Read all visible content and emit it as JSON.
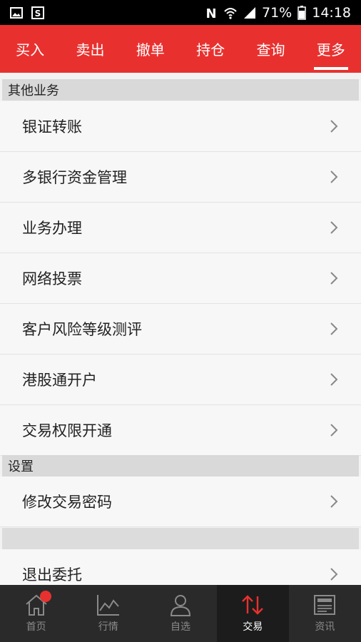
{
  "status_bar": {
    "battery": "71%",
    "time": "14:18"
  },
  "tabs": [
    {
      "label": "买入",
      "active": false
    },
    {
      "label": "卖出",
      "active": false
    },
    {
      "label": "撤单",
      "active": false
    },
    {
      "label": "持仓",
      "active": false
    },
    {
      "label": "查询",
      "active": false
    },
    {
      "label": "更多",
      "active": true
    }
  ],
  "sections": {
    "other": {
      "title": "其他业务",
      "items": [
        "银证转账",
        "多银行资金管理",
        "业务办理",
        "网络投票",
        "客户风险等级测评",
        "港股通开户",
        "交易权限开通"
      ]
    },
    "settings": {
      "title": "设置",
      "items": [
        "修改交易密码"
      ]
    },
    "exit": {
      "label": "退出委托"
    }
  },
  "bottom_nav": [
    {
      "label": "首页",
      "icon": "home-icon",
      "active": false,
      "badge": true
    },
    {
      "label": "行情",
      "icon": "chart-icon",
      "active": false
    },
    {
      "label": "自选",
      "icon": "person-icon",
      "active": false
    },
    {
      "label": "交易",
      "icon": "transfer-icon",
      "active": true
    },
    {
      "label": "资讯",
      "icon": "news-icon",
      "active": false
    }
  ],
  "colors": {
    "accent": "#e8312f",
    "nav_bg": "#2a2a2a"
  }
}
